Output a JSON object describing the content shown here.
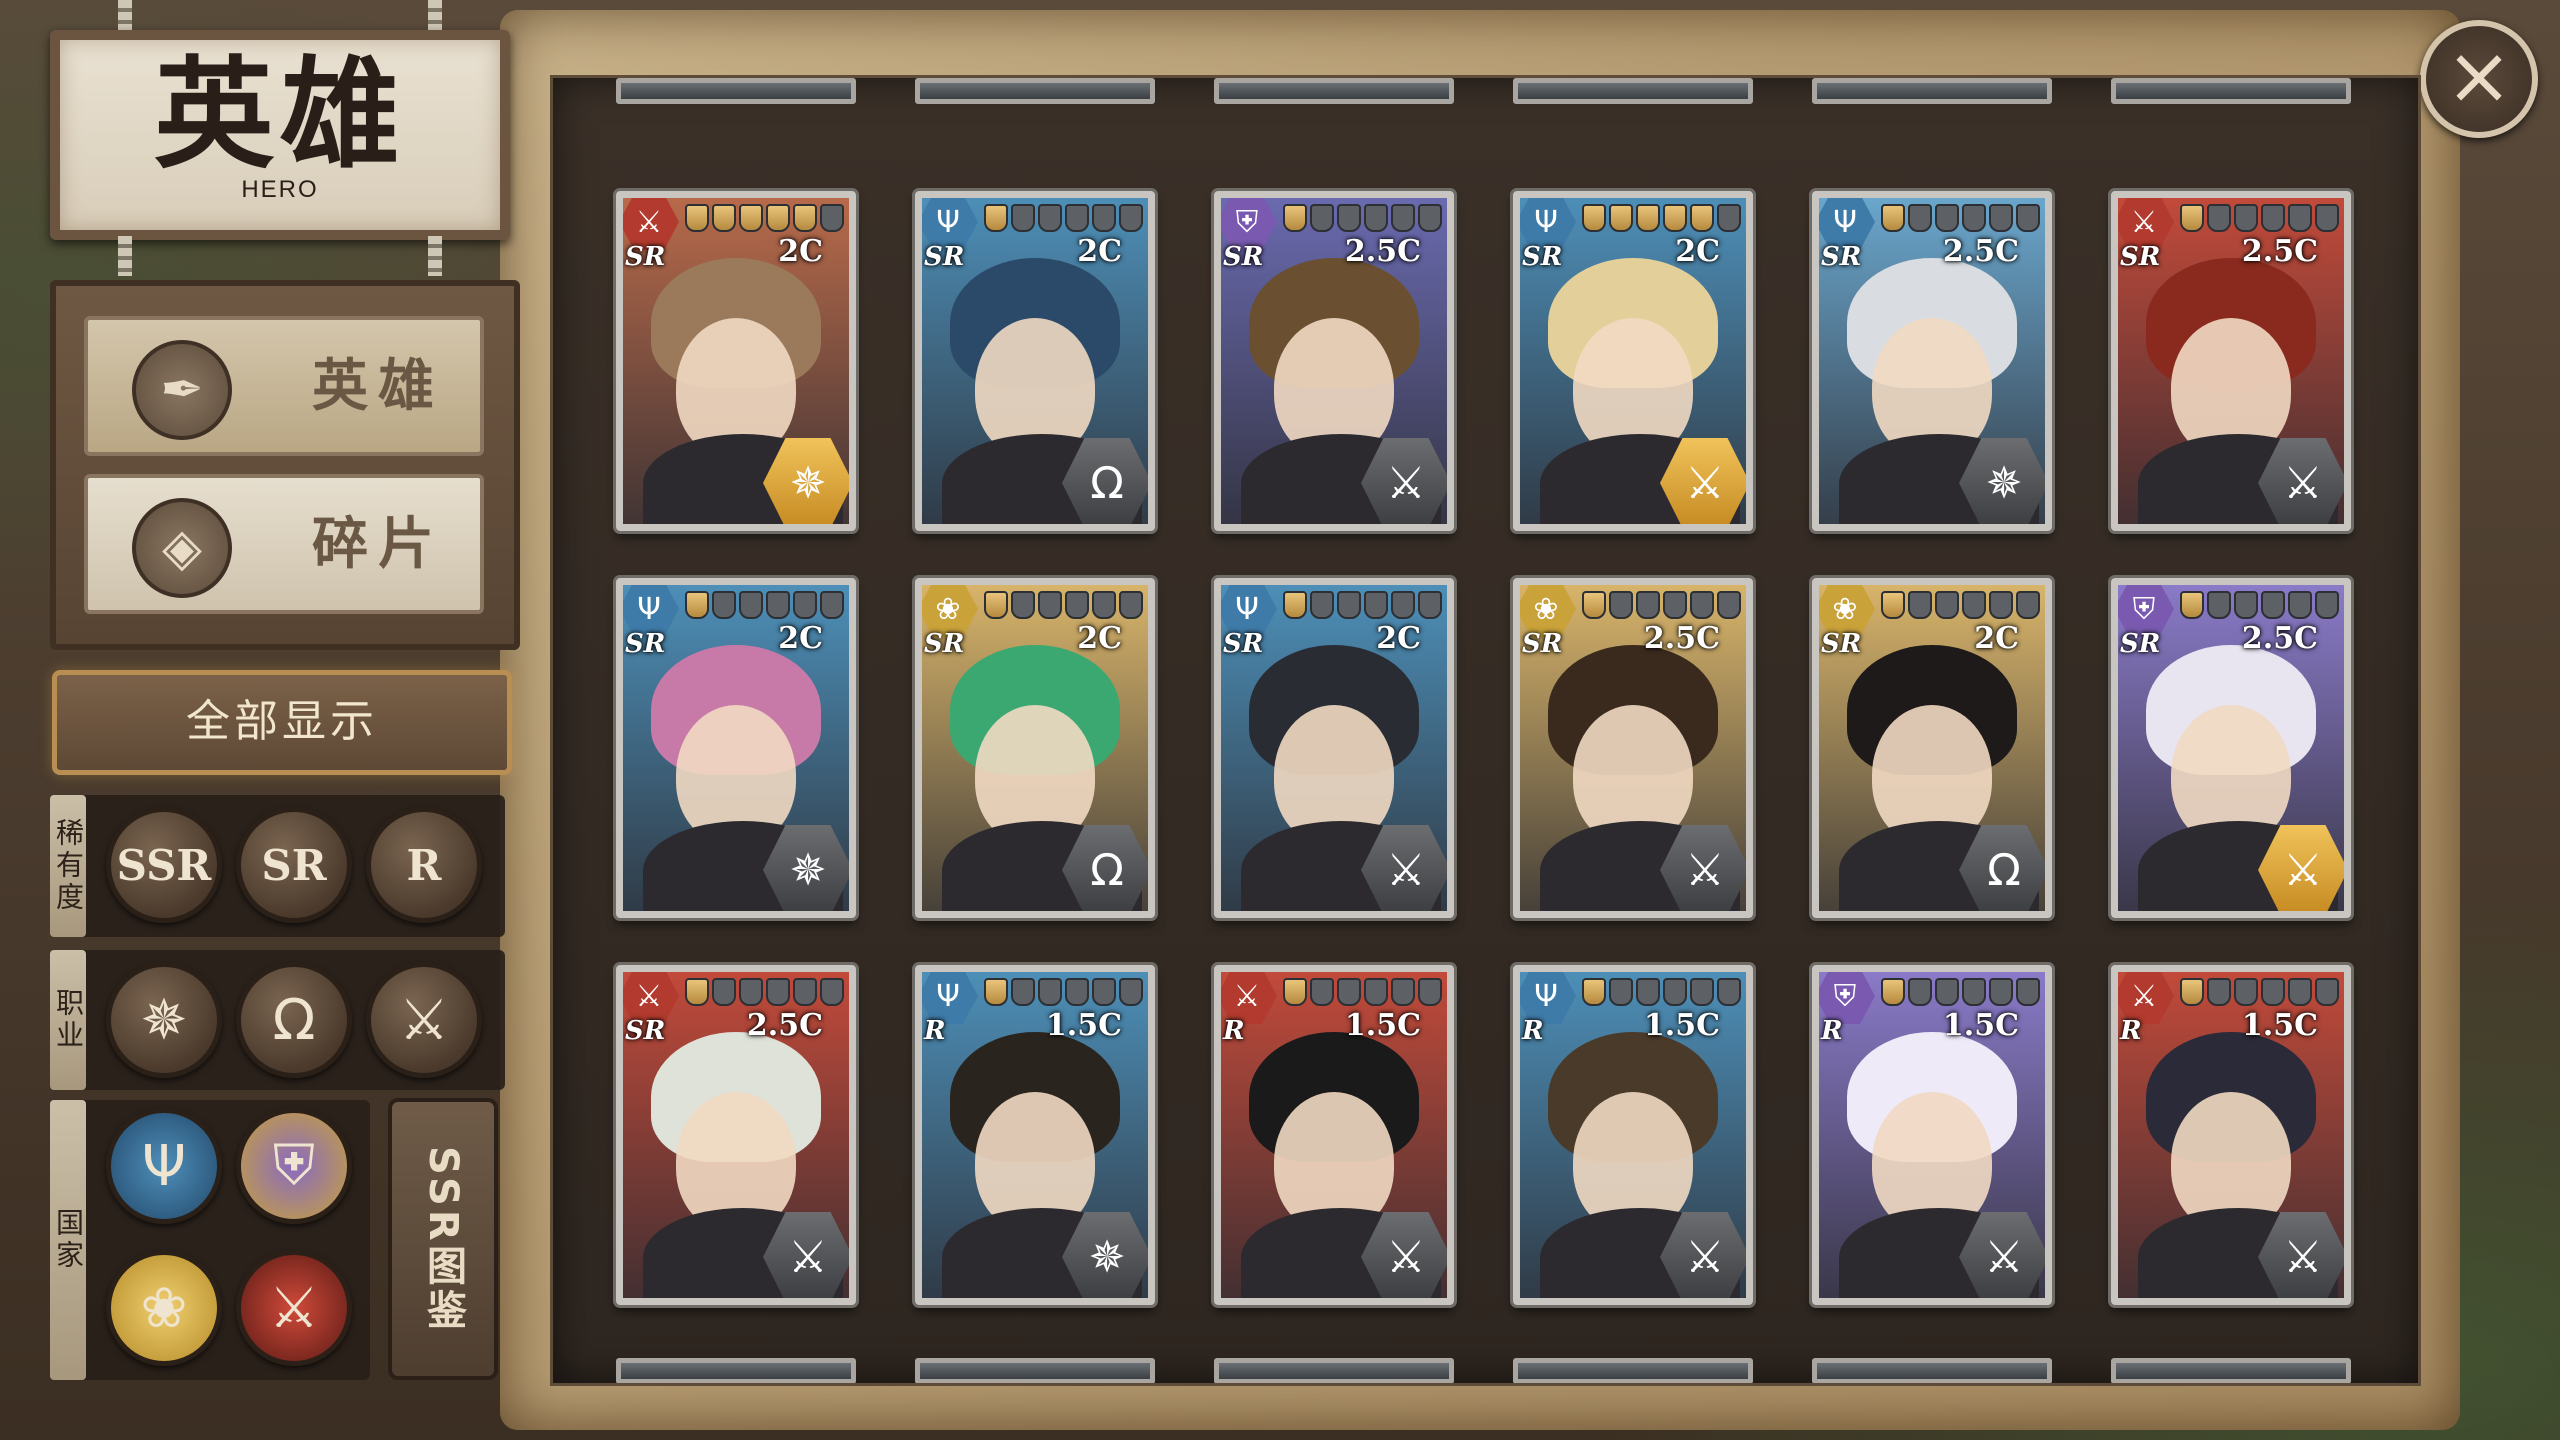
{
  "title": {
    "cn": "英雄",
    "en": "HERO"
  },
  "tabs": [
    {
      "label": "英雄",
      "icon": "hero-icon",
      "active": true
    },
    {
      "label": "碎片",
      "icon": "fragment-icon",
      "active": false
    }
  ],
  "show_all_label": "全部显示",
  "filters": {
    "rarity": {
      "tag": "稀有度",
      "options": [
        "SSR",
        "SR",
        "R"
      ]
    },
    "class": {
      "tag": "职业",
      "options": [
        "mage-class-icon",
        "support-class-icon",
        "warrior-class-icon"
      ]
    },
    "nation": {
      "tag": "国家",
      "options": [
        "trident-nation-icon",
        "shield-nation-icon",
        "lotus-nation-icon",
        "crossed-swords-nation-icon"
      ]
    }
  },
  "ssr_book_label": "SSR图鉴",
  "close_icon": "close-icon",
  "colors": {
    "accent_gold": "#b88e52",
    "panel": "#2e2620",
    "parchment": "#b69c72"
  },
  "cards": [
    {
      "rarity": "SR",
      "cost": "2C",
      "stars": 5,
      "nation": "crossed-swords",
      "class": "mage",
      "cls_color": "gold",
      "bg": "#b86a4a",
      "hair": "#9a7a5a"
    },
    {
      "rarity": "SR",
      "cost": "2C",
      "stars": 1,
      "nation": "trident",
      "class": "support",
      "cls_color": "dark",
      "bg": "#4d8fb8",
      "hair": "#2b4a6a"
    },
    {
      "rarity": "SR",
      "cost": "2.5C",
      "stars": 1,
      "nation": "shield",
      "class": "warrior",
      "cls_color": "dark",
      "bg": "#6a6ab0",
      "hair": "#6a5030"
    },
    {
      "rarity": "SR",
      "cost": "2C",
      "stars": 5,
      "nation": "trident",
      "class": "warrior",
      "cls_color": "gold",
      "bg": "#4d8fb8",
      "hair": "#e3cf9a"
    },
    {
      "rarity": "SR",
      "cost": "2.5C",
      "stars": 1,
      "nation": "trident",
      "class": "mage",
      "cls_color": "dark",
      "bg": "#6aa6cc",
      "hair": "#d9dde2"
    },
    {
      "rarity": "SR",
      "cost": "2.5C",
      "stars": 1,
      "nation": "crossed-swords",
      "class": "warrior",
      "cls_color": "dark",
      "bg": "#c24a3a",
      "hair": "#8a2a1e"
    },
    {
      "rarity": "SR",
      "cost": "2C",
      "stars": 1,
      "nation": "trident",
      "class": "mage",
      "cls_color": "dark",
      "bg": "#4d8fb8",
      "hair": "#c77aa8"
    },
    {
      "rarity": "SR",
      "cost": "2C",
      "stars": 1,
      "nation": "lotus",
      "class": "support",
      "cls_color": "dark",
      "bg": "#d8b46a",
      "hair": "#3aa870"
    },
    {
      "rarity": "SR",
      "cost": "2C",
      "stars": 1,
      "nation": "trident",
      "class": "warrior",
      "cls_color": "dark",
      "bg": "#4d8fb8",
      "hair": "#2a2c34"
    },
    {
      "rarity": "SR",
      "cost": "2.5C",
      "stars": 1,
      "nation": "lotus",
      "class": "warrior",
      "cls_color": "dark",
      "bg": "#d8b46a",
      "hair": "#3a2a1e"
    },
    {
      "rarity": "SR",
      "cost": "2C",
      "stars": 1,
      "nation": "lotus",
      "class": "support",
      "cls_color": "dark",
      "bg": "#d8b46a",
      "hair": "#1e1a1a"
    },
    {
      "rarity": "SR",
      "cost": "2.5C",
      "stars": 1,
      "nation": "shield",
      "class": "warrior",
      "cls_color": "gold",
      "bg": "#8a7ac8",
      "hair": "#e8e4f0"
    },
    {
      "rarity": "SR",
      "cost": "2.5C",
      "stars": 1,
      "nation": "crossed-swords",
      "class": "warrior",
      "cls_color": "dark",
      "bg": "#c24a3a",
      "hair": "#dfe2d8"
    },
    {
      "rarity": "R",
      "cost": "1.5C",
      "stars": 1,
      "nation": "trident",
      "class": "mage",
      "cls_color": "dark",
      "bg": "#4d8fb8",
      "hair": "#2a241e"
    },
    {
      "rarity": "R",
      "cost": "1.5C",
      "stars": 1,
      "nation": "crossed-swords",
      "class": "warrior",
      "cls_color": "dark",
      "bg": "#c24a3a",
      "hair": "#1a1a1a"
    },
    {
      "rarity": "R",
      "cost": "1.5C",
      "stars": 1,
      "nation": "trident",
      "class": "warrior",
      "cls_color": "dark",
      "bg": "#4d8fb8",
      "hair": "#4a3a2a"
    },
    {
      "rarity": "R",
      "cost": "1.5C",
      "stars": 1,
      "nation": "shield",
      "class": "warrior",
      "cls_color": "dark",
      "bg": "#8a7ac8",
      "hair": "#eeeaf8"
    },
    {
      "rarity": "R",
      "cost": "1.5C",
      "stars": 1,
      "nation": "crossed-swords",
      "class": "warrior",
      "cls_color": "dark",
      "bg": "#c24a3a",
      "hair": "#2a2a38"
    }
  ]
}
